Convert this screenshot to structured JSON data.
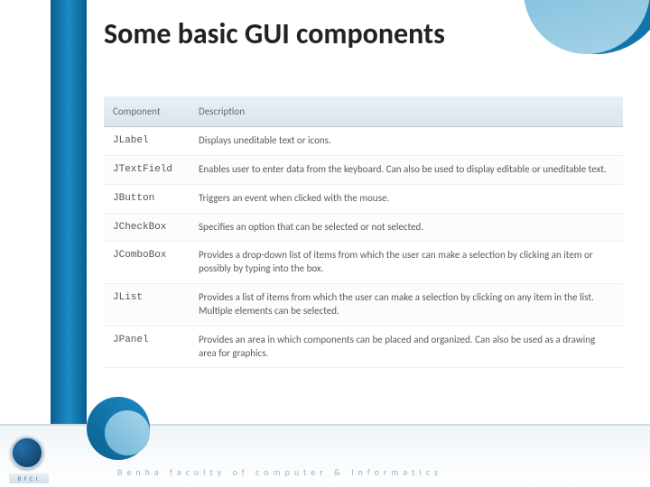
{
  "title": "Some basic GUI components",
  "table": {
    "headers": {
      "col1": "Component",
      "col2": "Description"
    },
    "rows": [
      {
        "name": "JLabel",
        "desc": "Displays uneditable text or icons."
      },
      {
        "name": "JTextField",
        "desc": "Enables user to enter data from the keyboard. Can also be used to display editable or uneditable text."
      },
      {
        "name": "JButton",
        "desc": "Triggers an event when clicked with the mouse."
      },
      {
        "name": "JCheckBox",
        "desc": "Specifies an option that can be selected or not selected."
      },
      {
        "name": "JComboBox",
        "desc": "Provides a drop-down list of items from which the user can make a selection by clicking an item or possibly by typing into the box."
      },
      {
        "name": "JList",
        "desc": "Provides a list of items from which the user can make a selection by clicking on any item in the list. Multiple elements can be selected."
      },
      {
        "name": "JPanel",
        "desc": "Provides an area in which components can be placed and organized. Can also be used as a drawing area for graphics."
      }
    ]
  },
  "footer": {
    "bfci": "BFCI",
    "text": "Benha faculty of computer & Informatics"
  }
}
